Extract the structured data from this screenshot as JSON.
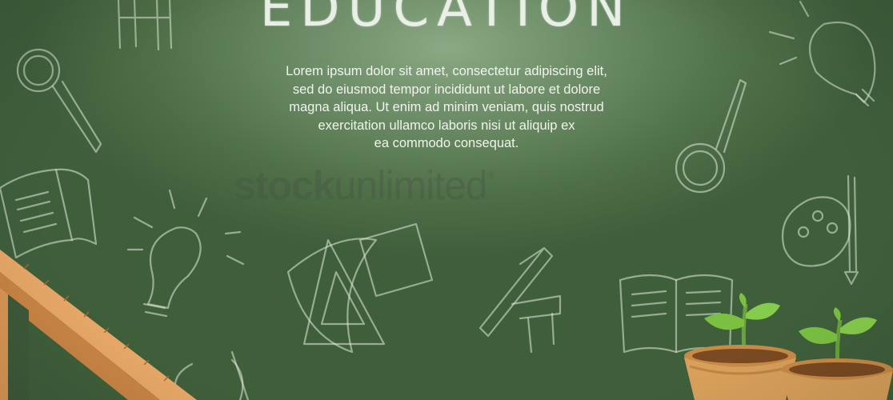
{
  "headline": "EDUCATION",
  "paragraph": [
    "Lorem ipsum dolor sit amet, consectetur adipiscing elit,",
    "sed do eiusmod tempor incididunt ut labore et dolore",
    "magna aliqua. Ut enim ad minim veniam, quis nostrud",
    "exercitation ullamco laboris nisi ut aliquip ex",
    "ea commodo consequat."
  ],
  "watermark": {
    "bold": "stock",
    "light": "unlimited",
    "mark": "®"
  },
  "colors": {
    "chalkboard": "#5a7a54",
    "chalk": "#f2f4ee",
    "ruler": "#e8a867",
    "pot": "#d8a05a",
    "leaf": "#7ac142"
  },
  "icons": [
    "chair-icon",
    "magnifier-icon",
    "lightbulb-icon",
    "open-book-icon",
    "set-square-icon",
    "paint-palette-icon",
    "seedling-icon"
  ]
}
